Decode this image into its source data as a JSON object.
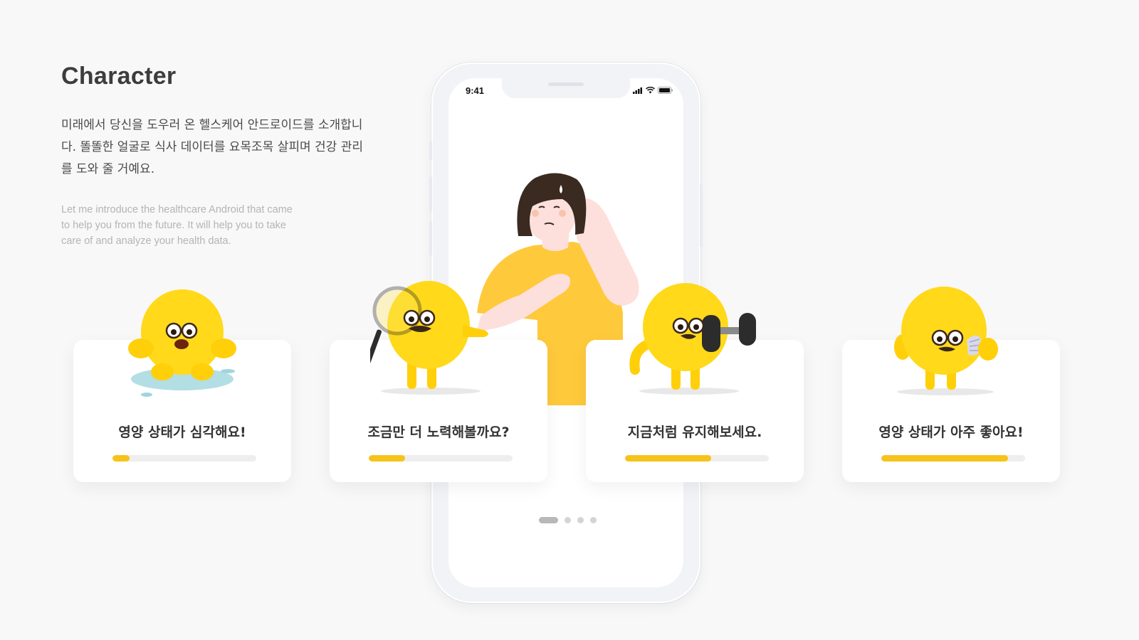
{
  "header": {
    "title": "Character",
    "description_ko": "미래에서 당신을 도우러 온 헬스케어 안드로이드를 소개합니다. 똘똘한 얼굴로 식사 데이터를 요목조목 살피며 건강 관리를 도와 줄 거예요.",
    "description_en": "Let me introduce the healthcare Android that came to help you from the future. It will help you to take care of and analyze your health data."
  },
  "phone": {
    "status_time": "9:41",
    "pager": {
      "total": 4,
      "active_index": 0
    }
  },
  "cards": [
    {
      "label": "영양 상태가 심각해요!",
      "progress": 0.12,
      "character": "puddle-character-icon"
    },
    {
      "label": "조금만 더 노력해볼까요?",
      "progress": 0.25,
      "character": "magnifier-character-icon"
    },
    {
      "label": "지금처럼 유지해보세요.",
      "progress": 0.6,
      "character": "dumbbell-character-icon"
    },
    {
      "label": "영양 상태가 아주 좋아요!",
      "progress": 0.88,
      "character": "shell-character-icon"
    }
  ],
  "colors": {
    "accent_yellow": "#f7c31b",
    "character_yellow": "#ffd91a",
    "background": "#f8f8f8",
    "bar_track": "#eeeeee"
  }
}
